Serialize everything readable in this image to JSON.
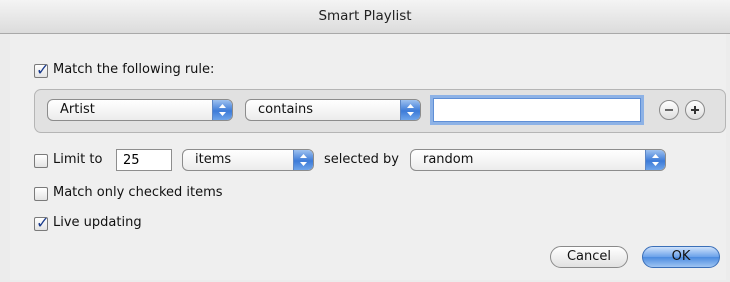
{
  "window": {
    "title": "Smart Playlist"
  },
  "match_rule": {
    "checked": true,
    "label": "Match the following rule:"
  },
  "rule": {
    "field": "Artist",
    "operator": "contains",
    "value": "",
    "remove_icon": "minus-circle-icon",
    "add_icon": "plus-circle-icon"
  },
  "limit": {
    "checked": false,
    "label": "Limit to",
    "count": "25",
    "unit": "items",
    "selected_by_label": "selected by",
    "selected_by_value": "random"
  },
  "match_checked": {
    "checked": false,
    "label": "Match only checked items"
  },
  "live_updating": {
    "checked": true,
    "label": "Live updating"
  },
  "buttons": {
    "cancel": "Cancel",
    "ok": "OK"
  },
  "colors": {
    "accent": "#3d7bd8",
    "check": "#1a3b8c",
    "focus_ring": "#8db2e6"
  }
}
